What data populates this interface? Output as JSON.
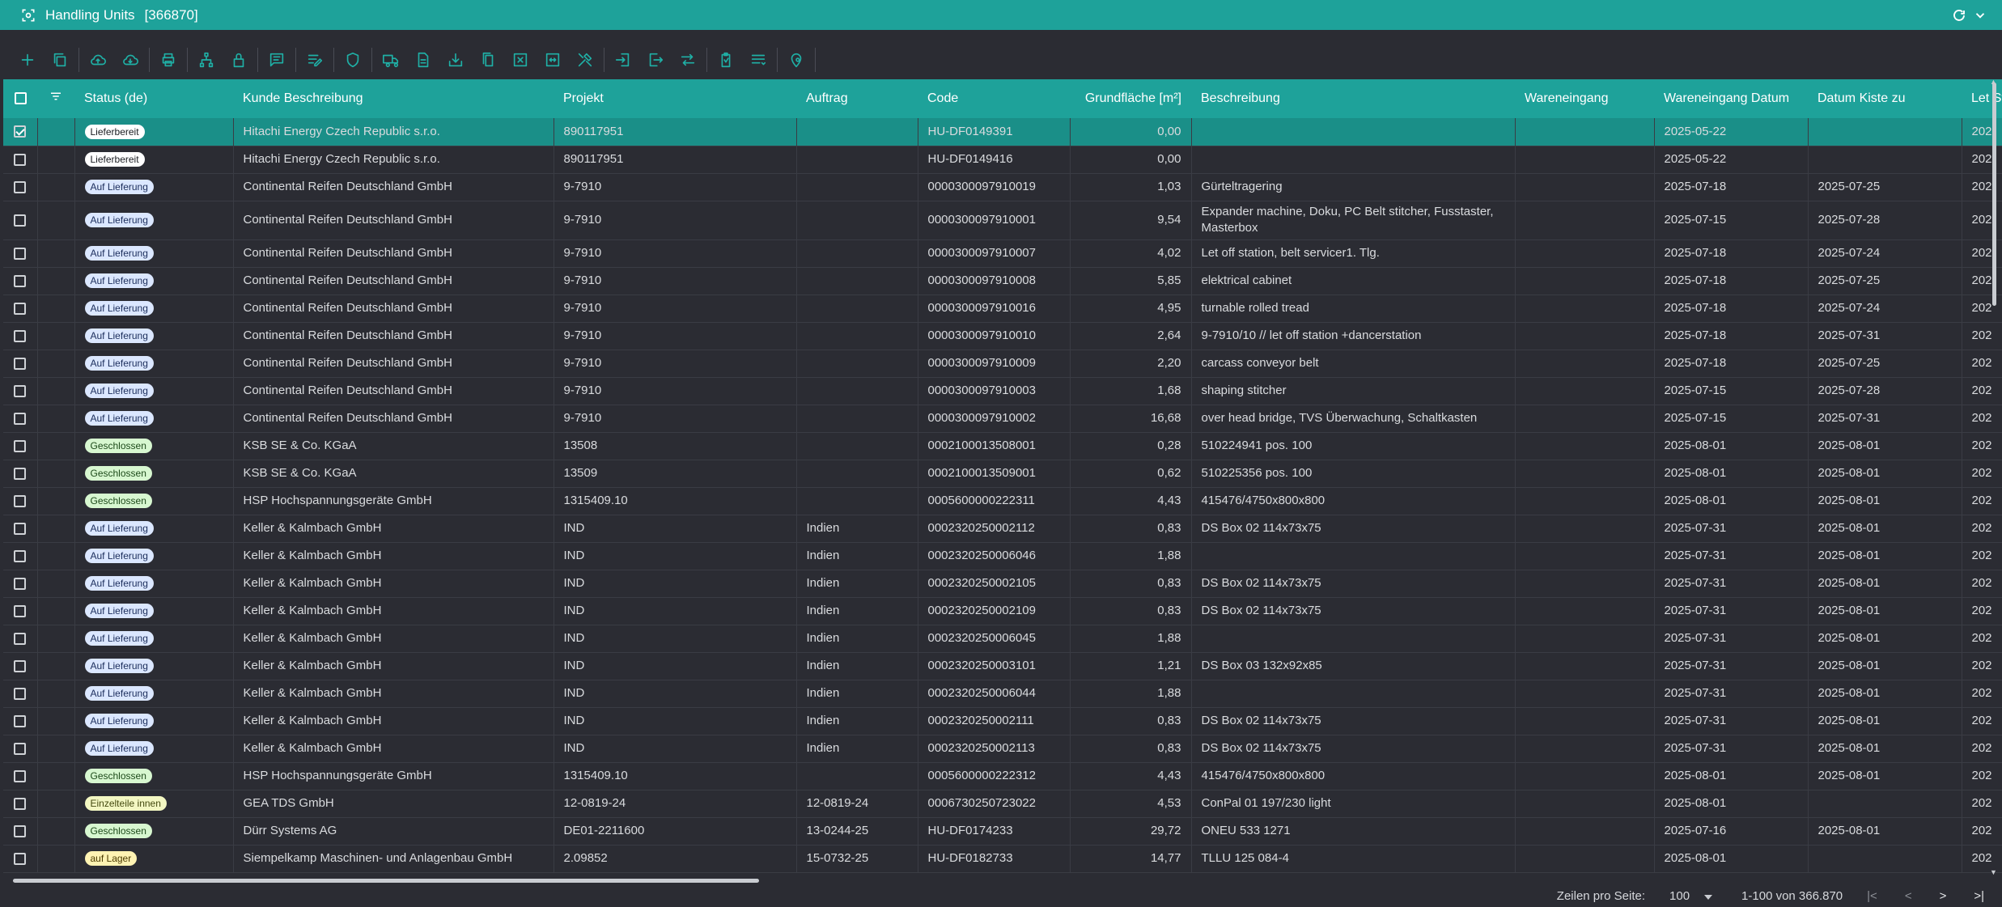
{
  "app": {
    "title": "Handling Units",
    "count": "[366870]"
  },
  "grid": {
    "columns": {
      "status": "Status (de)",
      "kunde": "Kunde Beschreibung",
      "projekt": "Projekt",
      "auftrag": "Auftrag",
      "code": "Code",
      "grundflaeche": "Grundfläche [m²]",
      "beschreibung": "Beschreibung",
      "wareneingang": "Wareneingang",
      "wareneingang_datum": "Wareneingang Datum",
      "datum_kiste_zu": "Datum Kiste zu",
      "next_col": "Let Sta"
    },
    "rows": [
      {
        "selected": true,
        "status": "Lieferbereit",
        "kind": "liefer",
        "kunde": "Hitachi Energy Czech Republic s.r.o.",
        "projekt": "890117951",
        "auftrag": "",
        "code": "HU-DF0149391",
        "grundflaeche": "0,00",
        "beschreibung": "",
        "wareneingang": "",
        "we_datum": "2025-05-22",
        "kiste_zu": "",
        "next": "202"
      },
      {
        "selected": false,
        "status": "Lieferbereit",
        "kind": "liefer",
        "kunde": "Hitachi Energy Czech Republic s.r.o.",
        "projekt": "890117951",
        "auftrag": "",
        "code": "HU-DF0149416",
        "grundflaeche": "0,00",
        "beschreibung": "",
        "wareneingang": "",
        "we_datum": "2025-05-22",
        "kiste_zu": "",
        "next": "202"
      },
      {
        "selected": false,
        "status": "Auf Lieferung",
        "kind": "auf",
        "kunde": "Continental Reifen Deutschland GmbH",
        "projekt": "9-7910",
        "auftrag": "",
        "code": "0000300097910019",
        "grundflaeche": "1,03",
        "beschreibung": "Gürteltragering",
        "wareneingang": "",
        "we_datum": "2025-07-18",
        "kiste_zu": "2025-07-25",
        "next": "202"
      },
      {
        "selected": false,
        "tall": true,
        "status": "Auf Lieferung",
        "kind": "auf",
        "kunde": "Continental Reifen Deutschland GmbH",
        "projekt": "9-7910",
        "auftrag": "",
        "code": "0000300097910001",
        "grundflaeche": "9,54",
        "beschreibung": "Expander machine, Doku, PC Belt stitcher, Fusstaster, Masterbox",
        "wareneingang": "",
        "we_datum": "2025-07-15",
        "kiste_zu": "2025-07-28",
        "next": "202"
      },
      {
        "selected": false,
        "status": "Auf Lieferung",
        "kind": "auf",
        "kunde": "Continental Reifen Deutschland GmbH",
        "projekt": "9-7910",
        "auftrag": "",
        "code": "0000300097910007",
        "grundflaeche": "4,02",
        "beschreibung": "Let off station, belt servicer1. Tlg.",
        "wareneingang": "",
        "we_datum": "2025-07-18",
        "kiste_zu": "2025-07-24",
        "next": "202"
      },
      {
        "selected": false,
        "status": "Auf Lieferung",
        "kind": "auf",
        "kunde": "Continental Reifen Deutschland GmbH",
        "projekt": "9-7910",
        "auftrag": "",
        "code": "0000300097910008",
        "grundflaeche": "5,85",
        "beschreibung": "elektrical cabinet",
        "wareneingang": "",
        "we_datum": "2025-07-18",
        "kiste_zu": "2025-07-25",
        "next": "202"
      },
      {
        "selected": false,
        "status": "Auf Lieferung",
        "kind": "auf",
        "kunde": "Continental Reifen Deutschland GmbH",
        "projekt": "9-7910",
        "auftrag": "",
        "code": "0000300097910016",
        "grundflaeche": "4,95",
        "beschreibung": "turnable rolled tread",
        "wareneingang": "",
        "we_datum": "2025-07-18",
        "kiste_zu": "2025-07-24",
        "next": "202"
      },
      {
        "selected": false,
        "status": "Auf Lieferung",
        "kind": "auf",
        "kunde": "Continental Reifen Deutschland GmbH",
        "projekt": "9-7910",
        "auftrag": "",
        "code": "0000300097910010",
        "grundflaeche": "2,64",
        "beschreibung": "9-7910/10 // let off station +dancerstation",
        "wareneingang": "",
        "we_datum": "2025-07-18",
        "kiste_zu": "2025-07-31",
        "next": "202"
      },
      {
        "selected": false,
        "status": "Auf Lieferung",
        "kind": "auf",
        "kunde": "Continental Reifen Deutschland GmbH",
        "projekt": "9-7910",
        "auftrag": "",
        "code": "0000300097910009",
        "grundflaeche": "2,20",
        "beschreibung": "carcass conveyor belt",
        "wareneingang": "",
        "we_datum": "2025-07-18",
        "kiste_zu": "2025-07-25",
        "next": "202"
      },
      {
        "selected": false,
        "status": "Auf Lieferung",
        "kind": "auf",
        "kunde": "Continental Reifen Deutschland GmbH",
        "projekt": "9-7910",
        "auftrag": "",
        "code": "0000300097910003",
        "grundflaeche": "1,68",
        "beschreibung": "shaping stitcher",
        "wareneingang": "",
        "we_datum": "2025-07-15",
        "kiste_zu": "2025-07-28",
        "next": "202"
      },
      {
        "selected": false,
        "status": "Auf Lieferung",
        "kind": "auf",
        "kunde": "Continental Reifen Deutschland GmbH",
        "projekt": "9-7910",
        "auftrag": "",
        "code": "0000300097910002",
        "grundflaeche": "16,68",
        "beschreibung": "over head bridge, TVS Überwachung, Schaltkasten",
        "wareneingang": "",
        "we_datum": "2025-07-15",
        "kiste_zu": "2025-07-31",
        "next": "202"
      },
      {
        "selected": false,
        "status": "Geschlossen",
        "kind": "gesch",
        "kunde": "KSB SE & Co. KGaA",
        "projekt": "13508",
        "auftrag": "",
        "code": "0002100013508001",
        "grundflaeche": "0,28",
        "beschreibung": "510224941 pos. 100",
        "wareneingang": "",
        "we_datum": "2025-08-01",
        "kiste_zu": "2025-08-01",
        "next": "202"
      },
      {
        "selected": false,
        "status": "Geschlossen",
        "kind": "gesch",
        "kunde": "KSB SE & Co. KGaA",
        "projekt": "13509",
        "auftrag": "",
        "code": "0002100013509001",
        "grundflaeche": "0,62",
        "beschreibung": "510225356 pos. 100",
        "wareneingang": "",
        "we_datum": "2025-08-01",
        "kiste_zu": "2025-08-01",
        "next": "202"
      },
      {
        "selected": false,
        "status": "Geschlossen",
        "kind": "gesch",
        "kunde": "HSP Hochspannungsgeräte GmbH",
        "projekt": "1315409.10",
        "auftrag": "",
        "code": "0005600000222311",
        "grundflaeche": "4,43",
        "beschreibung": "415476/4750x800x800",
        "wareneingang": "",
        "we_datum": "2025-08-01",
        "kiste_zu": "2025-08-01",
        "next": "202"
      },
      {
        "selected": false,
        "status": "Auf Lieferung",
        "kind": "auf",
        "kunde": "Keller & Kalmbach GmbH",
        "projekt": "IND",
        "auftrag": "Indien",
        "code": "0002320250002112",
        "grundflaeche": "0,83",
        "beschreibung": "DS Box 02 114x73x75",
        "wareneingang": "",
        "we_datum": "2025-07-31",
        "kiste_zu": "2025-08-01",
        "next": "202"
      },
      {
        "selected": false,
        "status": "Auf Lieferung",
        "kind": "auf",
        "kunde": "Keller & Kalmbach GmbH",
        "projekt": "IND",
        "auftrag": "Indien",
        "code": "0002320250006046",
        "grundflaeche": "1,88",
        "beschreibung": "",
        "wareneingang": "",
        "we_datum": "2025-07-31",
        "kiste_zu": "2025-08-01",
        "next": "202"
      },
      {
        "selected": false,
        "status": "Auf Lieferung",
        "kind": "auf",
        "kunde": "Keller & Kalmbach GmbH",
        "projekt": "IND",
        "auftrag": "Indien",
        "code": "0002320250002105",
        "grundflaeche": "0,83",
        "beschreibung": "DS Box 02 114x73x75",
        "wareneingang": "",
        "we_datum": "2025-07-31",
        "kiste_zu": "2025-08-01",
        "next": "202"
      },
      {
        "selected": false,
        "status": "Auf Lieferung",
        "kind": "auf",
        "kunde": "Keller & Kalmbach GmbH",
        "projekt": "IND",
        "auftrag": "Indien",
        "code": "0002320250002109",
        "grundflaeche": "0,83",
        "beschreibung": "DS Box 02 114x73x75",
        "wareneingang": "",
        "we_datum": "2025-07-31",
        "kiste_zu": "2025-08-01",
        "next": "202"
      },
      {
        "selected": false,
        "status": "Auf Lieferung",
        "kind": "auf",
        "kunde": "Keller & Kalmbach GmbH",
        "projekt": "IND",
        "auftrag": "Indien",
        "code": "0002320250006045",
        "grundflaeche": "1,88",
        "beschreibung": "",
        "wareneingang": "",
        "we_datum": "2025-07-31",
        "kiste_zu": "2025-08-01",
        "next": "202"
      },
      {
        "selected": false,
        "status": "Auf Lieferung",
        "kind": "auf",
        "kunde": "Keller & Kalmbach GmbH",
        "projekt": "IND",
        "auftrag": "Indien",
        "code": "0002320250003101",
        "grundflaeche": "1,21",
        "beschreibung": "DS Box 03 132x92x85",
        "wareneingang": "",
        "we_datum": "2025-07-31",
        "kiste_zu": "2025-08-01",
        "next": "202"
      },
      {
        "selected": false,
        "status": "Auf Lieferung",
        "kind": "auf",
        "kunde": "Keller & Kalmbach GmbH",
        "projekt": "IND",
        "auftrag": "Indien",
        "code": "0002320250006044",
        "grundflaeche": "1,88",
        "beschreibung": "",
        "wareneingang": "",
        "we_datum": "2025-07-31",
        "kiste_zu": "2025-08-01",
        "next": "202"
      },
      {
        "selected": false,
        "status": "Auf Lieferung",
        "kind": "auf",
        "kunde": "Keller & Kalmbach GmbH",
        "projekt": "IND",
        "auftrag": "Indien",
        "code": "0002320250002111",
        "grundflaeche": "0,83",
        "beschreibung": "DS Box 02 114x73x75",
        "wareneingang": "",
        "we_datum": "2025-07-31",
        "kiste_zu": "2025-08-01",
        "next": "202"
      },
      {
        "selected": false,
        "status": "Auf Lieferung",
        "kind": "auf",
        "kunde": "Keller & Kalmbach GmbH",
        "projekt": "IND",
        "auftrag": "Indien",
        "code": "0002320250002113",
        "grundflaeche": "0,83",
        "beschreibung": "DS Box 02 114x73x75",
        "wareneingang": "",
        "we_datum": "2025-07-31",
        "kiste_zu": "2025-08-01",
        "next": "202"
      },
      {
        "selected": false,
        "status": "Geschlossen",
        "kind": "gesch",
        "kunde": "HSP Hochspannungsgeräte GmbH",
        "projekt": "1315409.10",
        "auftrag": "",
        "code": "0005600000222312",
        "grundflaeche": "4,43",
        "beschreibung": "415476/4750x800x800",
        "wareneingang": "",
        "we_datum": "2025-08-01",
        "kiste_zu": "2025-08-01",
        "next": "202"
      },
      {
        "selected": false,
        "status": "Einzelteile innen",
        "kind": "einz",
        "kunde": "GEA TDS GmbH",
        "projekt": "12-0819-24",
        "auftrag": "12-0819-24",
        "code": "0006730250723022",
        "grundflaeche": "4,53",
        "beschreibung": "ConPal 01 197/230 light",
        "wareneingang": "",
        "we_datum": "2025-08-01",
        "kiste_zu": "",
        "next": "202"
      },
      {
        "selected": false,
        "status": "Geschlossen",
        "kind": "gesch",
        "kunde": "Dürr Systems AG",
        "projekt": "DE01-2211600",
        "auftrag": "13-0244-25",
        "code": "HU-DF0174233",
        "grundflaeche": "29,72",
        "beschreibung": "ONEU 533 1271",
        "wareneingang": "",
        "we_datum": "2025-07-16",
        "kiste_zu": "2025-08-01",
        "next": "202"
      },
      {
        "selected": false,
        "status": "auf Lager",
        "kind": "lager",
        "kunde": "Siempelkamp Maschinen- und Anlagenbau GmbH",
        "projekt": "2.09852",
        "auftrag": "15-0732-25",
        "code": "HU-DF0182733",
        "grundflaeche": "14,77",
        "beschreibung": "TLLU 125 084-4",
        "wareneingang": "",
        "we_datum": "2025-08-01",
        "kiste_zu": "",
        "next": "202"
      }
    ]
  },
  "footer": {
    "rows_per_page_label": "Zeilen pro Seite:",
    "rows_per_page_value": "100",
    "range": "1-100 von 366.870"
  },
  "icons": {
    "toolbar": [
      "add-icon",
      "copy-icon",
      "cloud-upload-icon",
      "cloud-download-icon",
      "print-icon",
      "hierarchy-icon",
      "lock-icon",
      "comment-icon",
      "edit-list-icon",
      "shield-icon",
      "truck-icon",
      "document-icon",
      "download-box-icon",
      "files-icon",
      "close-box-icon",
      "expand-icon",
      "tools-icon",
      "login-icon",
      "logout-icon",
      "swap-icon",
      "clipboard-icon",
      "list-icon",
      "location-pin-icon"
    ]
  },
  "colors": {
    "accent": "#1ea29a",
    "background": "#2b2c33",
    "selected_row": "#1a8f88"
  }
}
